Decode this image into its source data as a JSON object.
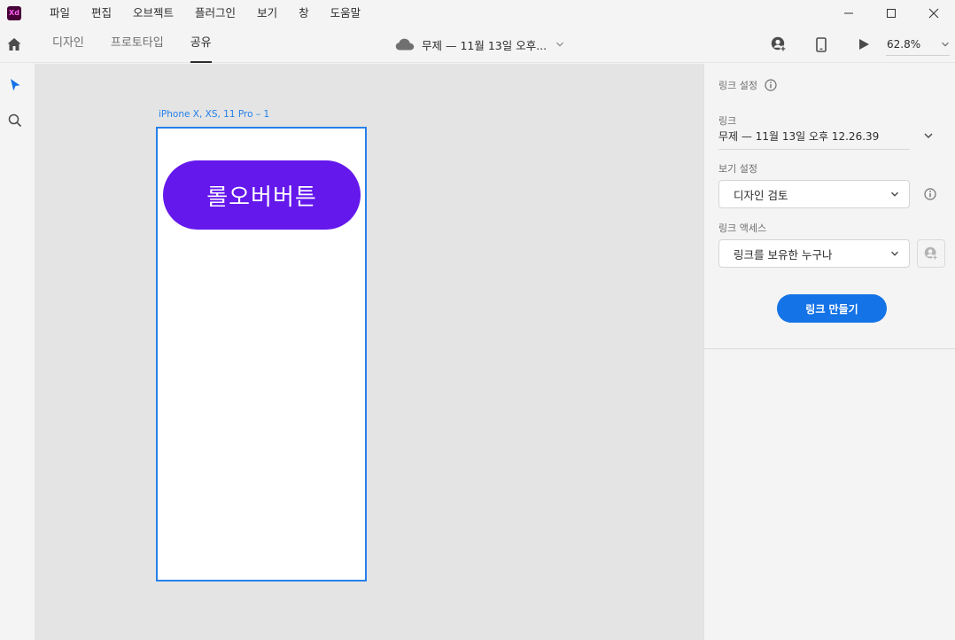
{
  "app": {
    "logo_text": "Xd",
    "menu": [
      "파일",
      "편집",
      "오브젝트",
      "플러그인",
      "보기",
      "창",
      "도움말"
    ]
  },
  "toolbar": {
    "tabs": [
      {
        "label": "디자인",
        "active": false
      },
      {
        "label": "프로토타입",
        "active": false
      },
      {
        "label": "공유",
        "active": true
      }
    ],
    "document_title": "무제 — 11월 13일 오후...",
    "zoom": "62.8%"
  },
  "canvas": {
    "artboard_label": "iPhone X, XS, 11 Pro – 1",
    "button_text": "롤오버버튼",
    "button_color": "#6418ec",
    "selection_color": "#2680eb"
  },
  "share_panel": {
    "section_title": "링크 설정",
    "link_label": "링크",
    "link_value": "무제 — 11월 13일 오후 12.26.39",
    "view_setting_label": "보기 설정",
    "view_setting_value": "디자인 검토",
    "link_access_label": "링크 액세스",
    "link_access_value": "링크를 보유한 누구나",
    "create_link_button": "링크 만들기",
    "accent_color": "#1473e6"
  }
}
